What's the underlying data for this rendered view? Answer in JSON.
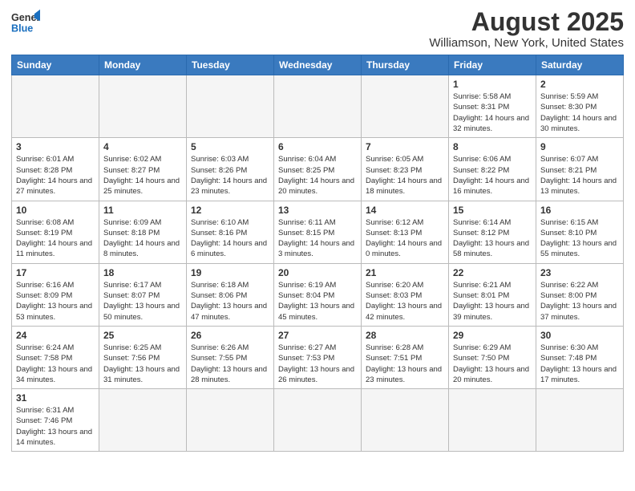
{
  "header": {
    "logo_general": "General",
    "logo_blue": "Blue",
    "title": "August 2025",
    "subtitle": "Williamson, New York, United States"
  },
  "weekdays": [
    "Sunday",
    "Monday",
    "Tuesday",
    "Wednesday",
    "Thursday",
    "Friday",
    "Saturday"
  ],
  "weeks": [
    [
      {
        "day": "",
        "info": ""
      },
      {
        "day": "",
        "info": ""
      },
      {
        "day": "",
        "info": ""
      },
      {
        "day": "",
        "info": ""
      },
      {
        "day": "",
        "info": ""
      },
      {
        "day": "1",
        "info": "Sunrise: 5:58 AM\nSunset: 8:31 PM\nDaylight: 14 hours and 32 minutes."
      },
      {
        "day": "2",
        "info": "Sunrise: 5:59 AM\nSunset: 8:30 PM\nDaylight: 14 hours and 30 minutes."
      }
    ],
    [
      {
        "day": "3",
        "info": "Sunrise: 6:01 AM\nSunset: 8:28 PM\nDaylight: 14 hours and 27 minutes."
      },
      {
        "day": "4",
        "info": "Sunrise: 6:02 AM\nSunset: 8:27 PM\nDaylight: 14 hours and 25 minutes."
      },
      {
        "day": "5",
        "info": "Sunrise: 6:03 AM\nSunset: 8:26 PM\nDaylight: 14 hours and 23 minutes."
      },
      {
        "day": "6",
        "info": "Sunrise: 6:04 AM\nSunset: 8:25 PM\nDaylight: 14 hours and 20 minutes."
      },
      {
        "day": "7",
        "info": "Sunrise: 6:05 AM\nSunset: 8:23 PM\nDaylight: 14 hours and 18 minutes."
      },
      {
        "day": "8",
        "info": "Sunrise: 6:06 AM\nSunset: 8:22 PM\nDaylight: 14 hours and 16 minutes."
      },
      {
        "day": "9",
        "info": "Sunrise: 6:07 AM\nSunset: 8:21 PM\nDaylight: 14 hours and 13 minutes."
      }
    ],
    [
      {
        "day": "10",
        "info": "Sunrise: 6:08 AM\nSunset: 8:19 PM\nDaylight: 14 hours and 11 minutes."
      },
      {
        "day": "11",
        "info": "Sunrise: 6:09 AM\nSunset: 8:18 PM\nDaylight: 14 hours and 8 minutes."
      },
      {
        "day": "12",
        "info": "Sunrise: 6:10 AM\nSunset: 8:16 PM\nDaylight: 14 hours and 6 minutes."
      },
      {
        "day": "13",
        "info": "Sunrise: 6:11 AM\nSunset: 8:15 PM\nDaylight: 14 hours and 3 minutes."
      },
      {
        "day": "14",
        "info": "Sunrise: 6:12 AM\nSunset: 8:13 PM\nDaylight: 14 hours and 0 minutes."
      },
      {
        "day": "15",
        "info": "Sunrise: 6:14 AM\nSunset: 8:12 PM\nDaylight: 13 hours and 58 minutes."
      },
      {
        "day": "16",
        "info": "Sunrise: 6:15 AM\nSunset: 8:10 PM\nDaylight: 13 hours and 55 minutes."
      }
    ],
    [
      {
        "day": "17",
        "info": "Sunrise: 6:16 AM\nSunset: 8:09 PM\nDaylight: 13 hours and 53 minutes."
      },
      {
        "day": "18",
        "info": "Sunrise: 6:17 AM\nSunset: 8:07 PM\nDaylight: 13 hours and 50 minutes."
      },
      {
        "day": "19",
        "info": "Sunrise: 6:18 AM\nSunset: 8:06 PM\nDaylight: 13 hours and 47 minutes."
      },
      {
        "day": "20",
        "info": "Sunrise: 6:19 AM\nSunset: 8:04 PM\nDaylight: 13 hours and 45 minutes."
      },
      {
        "day": "21",
        "info": "Sunrise: 6:20 AM\nSunset: 8:03 PM\nDaylight: 13 hours and 42 minutes."
      },
      {
        "day": "22",
        "info": "Sunrise: 6:21 AM\nSunset: 8:01 PM\nDaylight: 13 hours and 39 minutes."
      },
      {
        "day": "23",
        "info": "Sunrise: 6:22 AM\nSunset: 8:00 PM\nDaylight: 13 hours and 37 minutes."
      }
    ],
    [
      {
        "day": "24",
        "info": "Sunrise: 6:24 AM\nSunset: 7:58 PM\nDaylight: 13 hours and 34 minutes."
      },
      {
        "day": "25",
        "info": "Sunrise: 6:25 AM\nSunset: 7:56 PM\nDaylight: 13 hours and 31 minutes."
      },
      {
        "day": "26",
        "info": "Sunrise: 6:26 AM\nSunset: 7:55 PM\nDaylight: 13 hours and 28 minutes."
      },
      {
        "day": "27",
        "info": "Sunrise: 6:27 AM\nSunset: 7:53 PM\nDaylight: 13 hours and 26 minutes."
      },
      {
        "day": "28",
        "info": "Sunrise: 6:28 AM\nSunset: 7:51 PM\nDaylight: 13 hours and 23 minutes."
      },
      {
        "day": "29",
        "info": "Sunrise: 6:29 AM\nSunset: 7:50 PM\nDaylight: 13 hours and 20 minutes."
      },
      {
        "day": "30",
        "info": "Sunrise: 6:30 AM\nSunset: 7:48 PM\nDaylight: 13 hours and 17 minutes."
      }
    ],
    [
      {
        "day": "31",
        "info": "Sunrise: 6:31 AM\nSunset: 7:46 PM\nDaylight: 13 hours and 14 minutes."
      },
      {
        "day": "",
        "info": ""
      },
      {
        "day": "",
        "info": ""
      },
      {
        "day": "",
        "info": ""
      },
      {
        "day": "",
        "info": ""
      },
      {
        "day": "",
        "info": ""
      },
      {
        "day": "",
        "info": ""
      }
    ]
  ]
}
